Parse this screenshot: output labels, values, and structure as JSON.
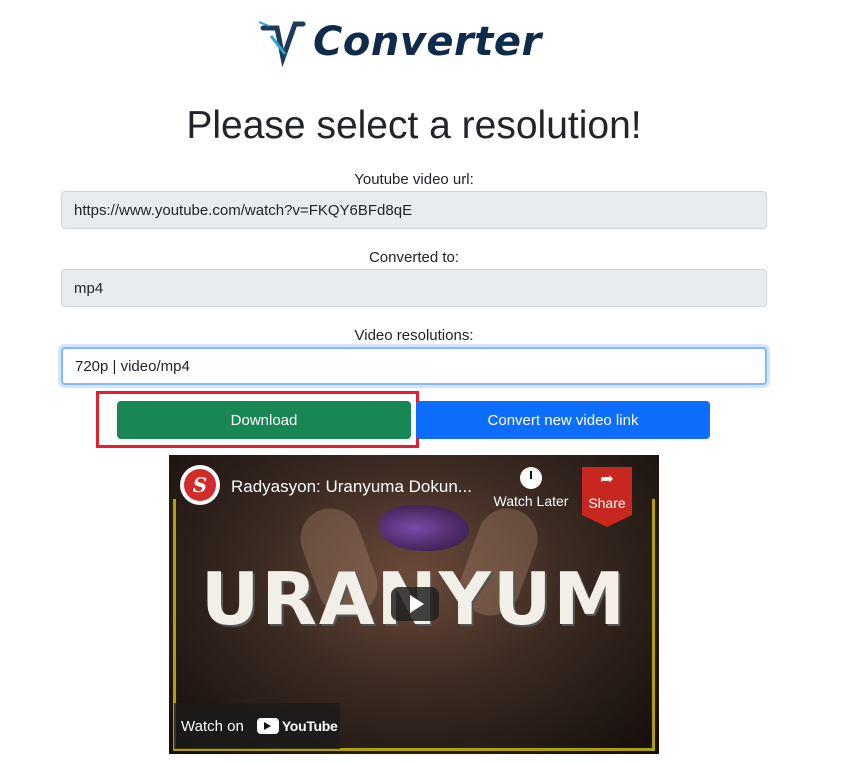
{
  "app": {
    "logo_text": "Converter"
  },
  "page": {
    "title": "Please select a resolution!"
  },
  "form": {
    "url_label": "Youtube video url:",
    "url_value": "https://www.youtube.com/watch?v=FKQY6BFd8qE",
    "converted_label": "Converted to:",
    "converted_value": "mp4",
    "resolution_label": "Video resolutions:",
    "resolution_value": "720p | video/mp4"
  },
  "buttons": {
    "download": "Download",
    "convert_new": "Convert new video link"
  },
  "video": {
    "title": "Radyasyon: Uranyuma Dokun...",
    "overlay_text": "URANYUM",
    "watch_later": "Watch Later",
    "share": "Share",
    "watch_on": "Watch on",
    "youtube": "YouTube",
    "channel_initial": "S"
  },
  "colors": {
    "download_button": "#198754",
    "convert_button": "#0d6efd",
    "highlight": "#e5202e"
  }
}
